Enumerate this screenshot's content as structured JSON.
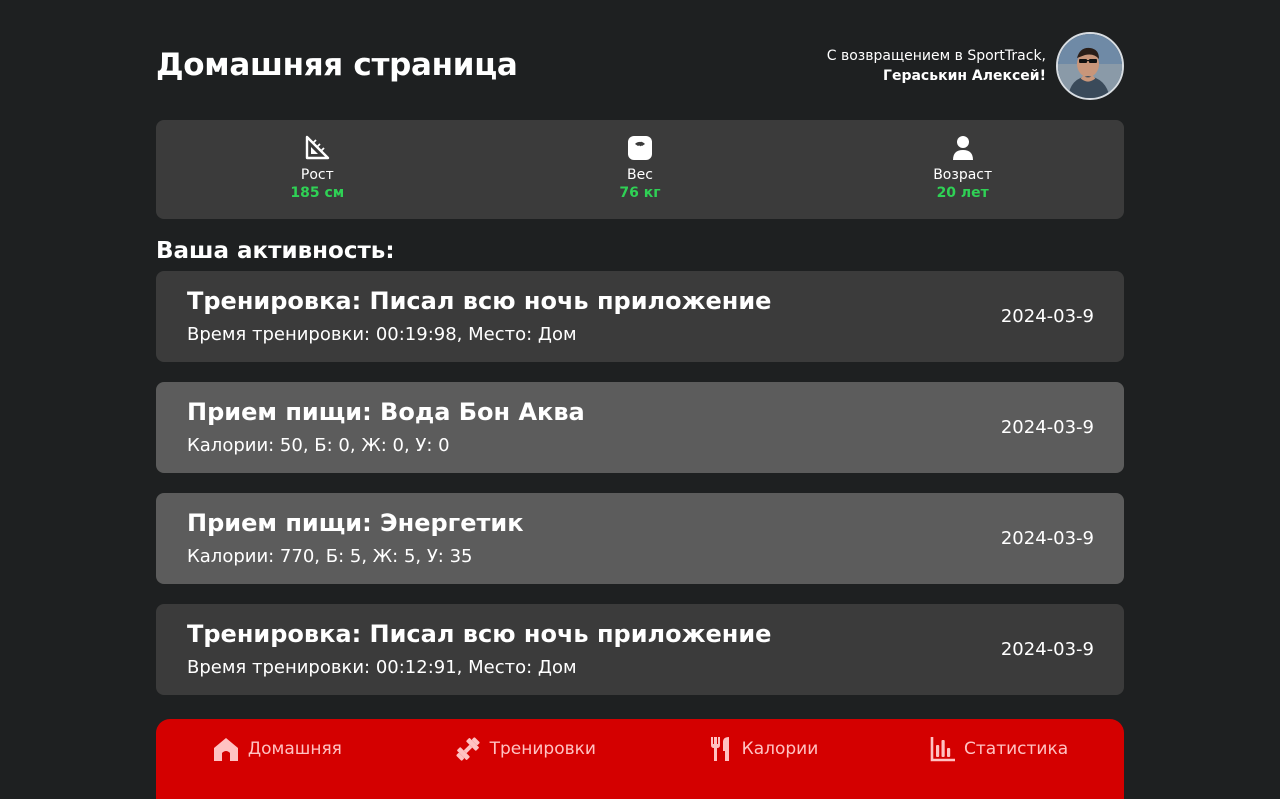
{
  "header": {
    "title": "Домашняя страница",
    "welcome_line": "С возвращением в SportTrack,",
    "user_name": "Гераськин Алексей!"
  },
  "stats": [
    {
      "icon": "ruler-triangle-icon",
      "label": "Рост",
      "value": "185 см"
    },
    {
      "icon": "scale-icon",
      "label": "Вес",
      "value": "76 кг"
    },
    {
      "icon": "person-icon",
      "label": "Возраст",
      "value": "20 лет"
    }
  ],
  "activity": {
    "heading": "Ваша активность:",
    "items": [
      {
        "type": "workout",
        "title": "Тренировка: Писал всю ночь приложение",
        "detail": "Время тренировки: 00:19:98, Место: Дом",
        "date": "2024-03-9"
      },
      {
        "type": "meal",
        "title": "Прием пищи: Вода Бон Аква",
        "detail": "Калории: 50, Б: 0, Ж: 0, У: 0",
        "date": "2024-03-9"
      },
      {
        "type": "meal",
        "title": "Прием пищи: Энергетик",
        "detail": "Калории: 770, Б: 5, Ж: 5, У: 35",
        "date": "2024-03-9"
      },
      {
        "type": "workout",
        "title": "Тренировка: Писал всю ночь приложение",
        "detail": "Время тренировки: 00:12:91, Место: Дом",
        "date": "2024-03-9"
      }
    ]
  },
  "nav": [
    {
      "icon": "home-icon",
      "label": "Домашняя"
    },
    {
      "icon": "dumbbell-icon",
      "label": "Тренировки"
    },
    {
      "icon": "fork-knife-icon",
      "label": "Калории"
    },
    {
      "icon": "bar-chart-icon",
      "label": "Статистика"
    }
  ],
  "colors": {
    "background": "#1e2021",
    "card_dark": "#3b3b3b",
    "card_light": "#5c5c5c",
    "accent_green": "#2fd155",
    "nav_red": "#d40000",
    "nav_text": "#ffc2c2"
  }
}
